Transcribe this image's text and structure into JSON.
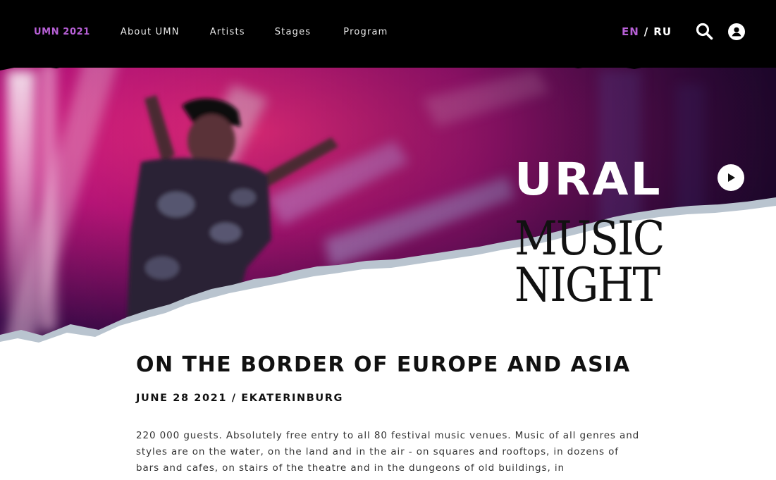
{
  "nav": {
    "brand": "UMN 2021",
    "items": [
      {
        "label": "About UMN"
      },
      {
        "label": "Artists"
      },
      {
        "label": "Stages"
      },
      {
        "label": "Program"
      }
    ]
  },
  "lang": {
    "active": "EN",
    "separator": "/",
    "other": "RU"
  },
  "icons": {
    "search": "search-icon",
    "account": "user-icon",
    "play": "play-icon"
  },
  "hero": {
    "logo_line1": "URAL",
    "logo_line2": "MUSIC",
    "logo_line3": "NIGHT"
  },
  "content": {
    "headline": "ON THE BORDER OF EUROPE AND ASIA",
    "dateline": "JUNE 28 2021 / EKATERINBURG",
    "body": "220 000 guests. Absolutely free entry to all 80 festival music venues. Music of all genres and styles are on the water, on the land and in the air - on squares and rooftops, in dozens of bars and cafes, on stairs of the theatre and in the dungeons of old buildings, in"
  },
  "colors": {
    "accent": "#b760d6",
    "header_bg": "#000000",
    "text": "#111111"
  }
}
